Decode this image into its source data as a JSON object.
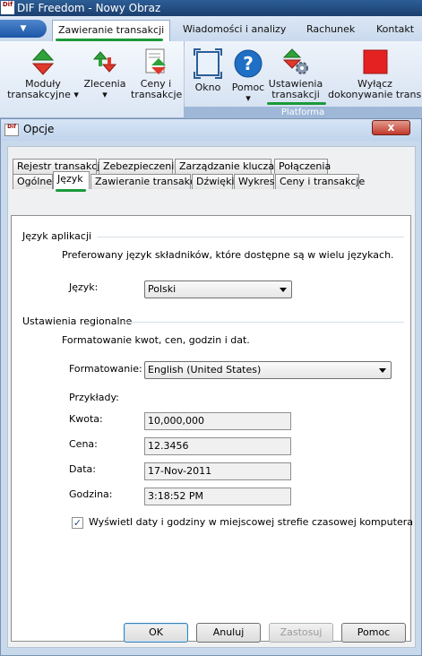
{
  "app": {
    "title": "DIF Freedom - Nowy Obraz",
    "logo_text": "Dif"
  },
  "ribbon": {
    "app_button_label": "▼",
    "tabs": [
      {
        "label": "Zawieranie transakcji"
      },
      {
        "label": "Wiadomości i analizy"
      },
      {
        "label": "Rachunek"
      },
      {
        "label": "Kontakt"
      }
    ],
    "buttons": {
      "moduly": "Moduły\ntransakcyjne ▾",
      "zlecenia": "Zlecenia\n▾",
      "ceny": "Ceny i\ntransakcje",
      "okno": "Okno",
      "pomoc": "Pomoc\n▾",
      "ustawienia": "Ustawienia\ntransakcji",
      "wylacz": "Wyłącz\ndokonywanie transakcji"
    },
    "group_label": "Platforma"
  },
  "dialog": {
    "title": "Opcje",
    "logo_text": "Dif",
    "close_label": "x",
    "tabs_row1": [
      "Rejestr transakcji",
      "Zebezpieczenie",
      "Zarządzanie kluczami",
      "Połączenia"
    ],
    "tabs_row2": [
      "Ogólne",
      "Język",
      "Zawieranie transakcji",
      "Dźwięki",
      "Wykres",
      "Ceny i transakcje"
    ],
    "language": {
      "group_title": "Język aplikacji",
      "description": "Preferowany język składników, które dostępne są w wielu językach.",
      "label": "Język:",
      "value": "Polski"
    },
    "regional": {
      "group_title": "Ustawienia regionalne",
      "description": "Formatowanie kwot, cen, godzin i dat.",
      "format_label": "Formatowanie:",
      "format_value": "English (United States)",
      "examples_label": "Przykłady:",
      "amount_label": "Kwota:",
      "amount_value": "10,000,000",
      "price_label": "Cena:",
      "price_value": "12.3456",
      "date_label": "Data:",
      "date_value": "17-Nov-2011",
      "time_label": "Godzina:",
      "time_value": "3:18:52 PM",
      "local_tz_checked": true,
      "local_tz_label": "Wyświetl daty i godziny w miejscowej strefie czasowej komputera"
    },
    "buttons": {
      "ok": "OK",
      "cancel": "Anuluj",
      "apply": "Zastosuj",
      "help": "Pomoc"
    }
  },
  "colors": {
    "highlight_underline": "#1a9a3a",
    "title_bar": "#1c3f6e"
  }
}
